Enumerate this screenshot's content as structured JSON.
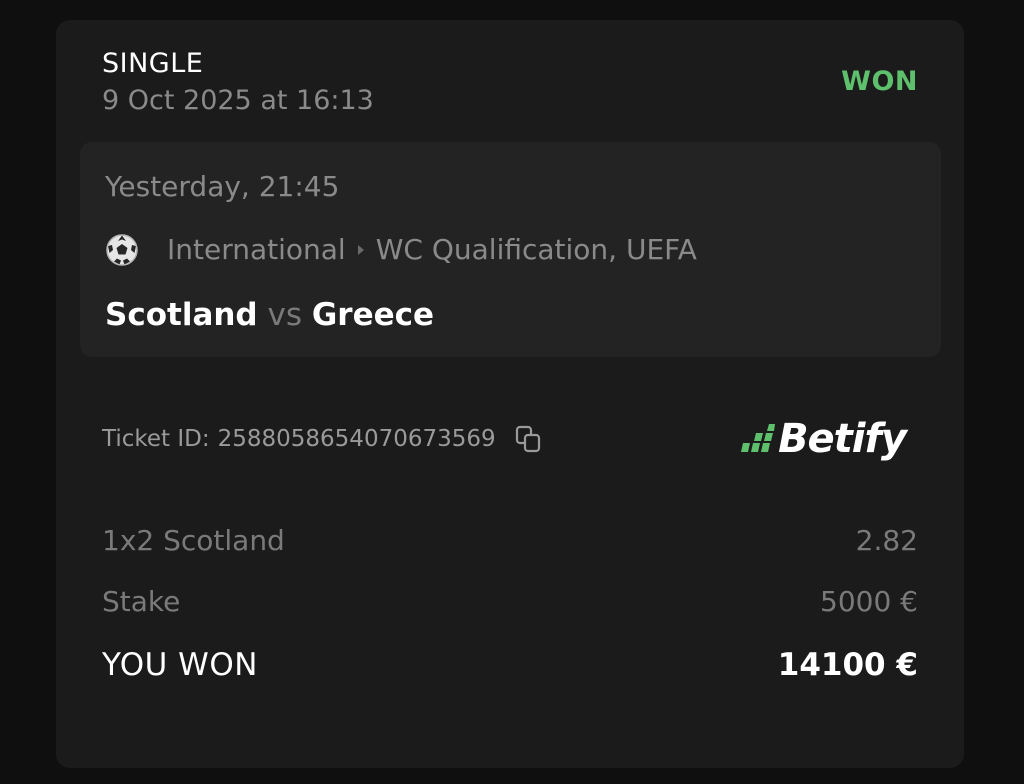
{
  "bet": {
    "type": "SINGLE",
    "placed_at": "9 Oct 2025 at 16:13",
    "status": "WON",
    "status_color": "#5ec06d"
  },
  "event": {
    "time": "Yesterday, 21:45",
    "sport_icon": "soccer-ball-icon",
    "category": "International",
    "separator_icon": "caret-right-icon",
    "league": "WC Qualification, UEFA",
    "home_team": "Scotland",
    "vs_label": "vs",
    "away_team": "Greece"
  },
  "ticket": {
    "label": "Ticket ID:",
    "id": "2588058654070673569",
    "copy_icon": "copy-icon"
  },
  "brand": {
    "name": "Betify",
    "accent_color": "#5ec06d"
  },
  "details": {
    "selection_label": "1x2 Scotland",
    "odds": "2.82",
    "stake_label": "Stake",
    "stake_value": "5000 €",
    "won_label": "YOU WON",
    "won_value": "14100 €"
  }
}
